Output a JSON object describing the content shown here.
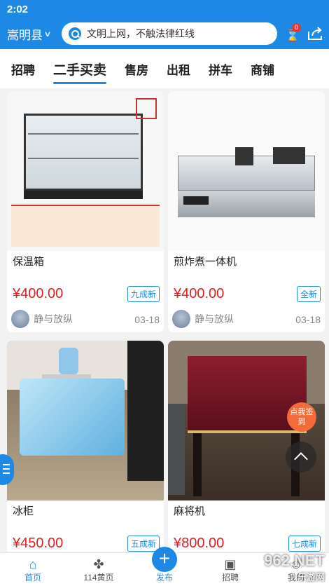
{
  "status": {
    "time": "2:02"
  },
  "header": {
    "location": "嵩明县",
    "search_placeholder": "文明上网，不触法律红线",
    "notification_count": "0"
  },
  "tabs": [
    {
      "label": "招聘"
    },
    {
      "label": "二手买卖"
    },
    {
      "label": "售房"
    },
    {
      "label": "出租"
    },
    {
      "label": "拼车"
    },
    {
      "label": "商铺"
    }
  ],
  "listings": [
    {
      "title": "保温箱",
      "price": "¥400.00",
      "condition": "九成新",
      "seller": "静与放纵",
      "date": "03-18"
    },
    {
      "title": "煎炸煮一体机",
      "price": "¥400.00",
      "condition": "全新",
      "seller": "静与放纵",
      "date": "03-18"
    },
    {
      "title": "冰柜",
      "price": "¥450.00",
      "condition": "五成新",
      "seller": "",
      "date": ""
    },
    {
      "title": "麻将机",
      "price": "¥800.00",
      "condition": "七成新",
      "seller": "",
      "date": ""
    }
  ],
  "float": {
    "sign_in": "点我签到"
  },
  "tabbar": {
    "home": "首页",
    "yellow_pages": "114黄页",
    "publish": "发布",
    "jobs": "招聘",
    "mine": "我的"
  },
  "watermark": {
    "brand": "962.NET",
    "sub": "乐游网"
  }
}
